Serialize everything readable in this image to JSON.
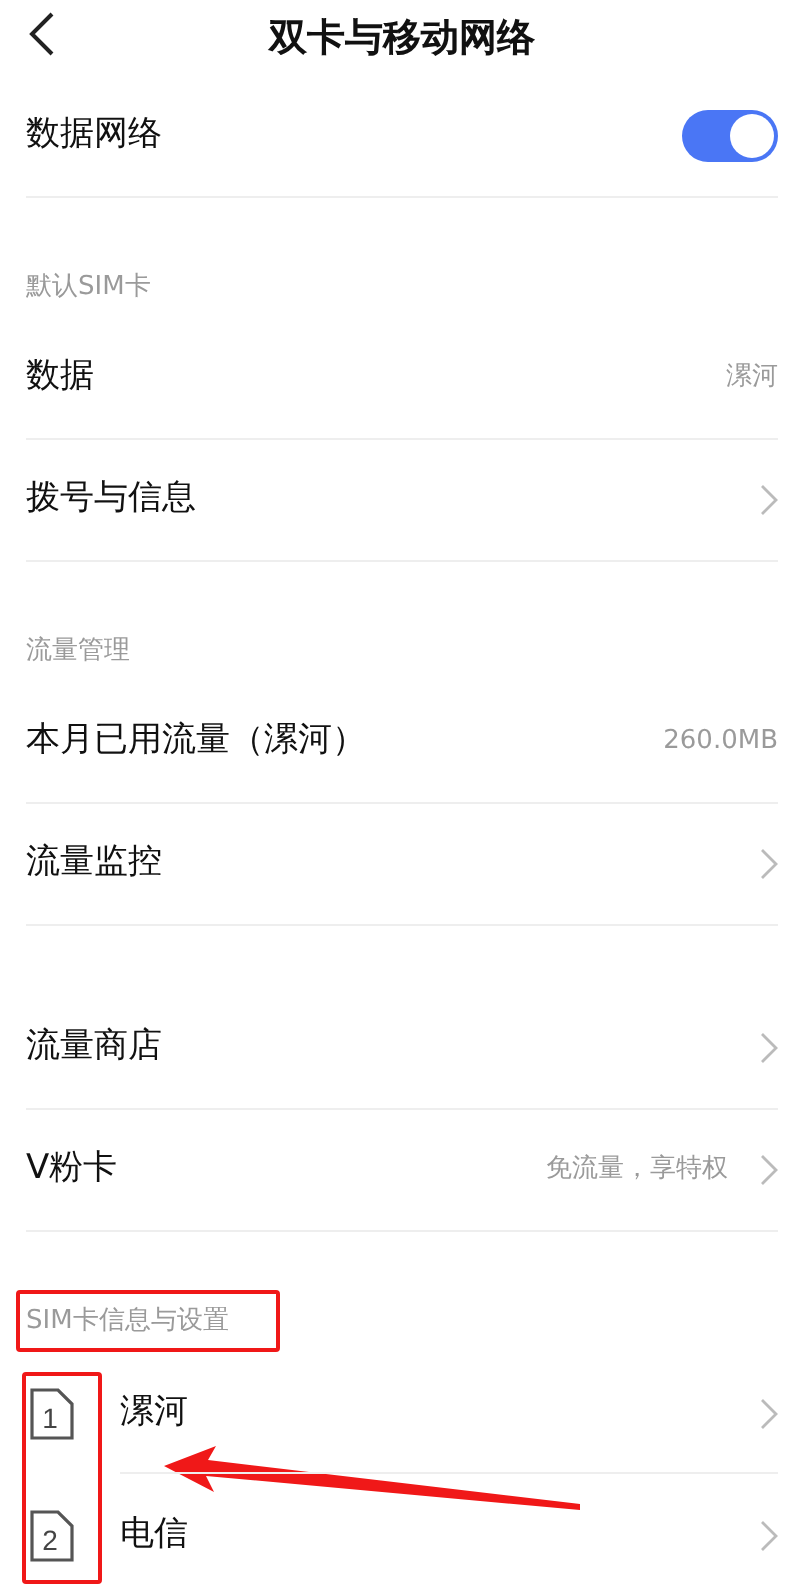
{
  "header": {
    "title": "双卡与移动网络"
  },
  "sections": [
    {
      "items": [
        {
          "kind": "toggle",
          "label": "数据网络",
          "on": true
        }
      ]
    },
    {
      "header": {
        "text": "默认SIM卡"
      },
      "items": [
        {
          "kind": "link",
          "label": "数据",
          "value": "漯河",
          "chevron": false
        },
        {
          "kind": "link",
          "label": "拨号与信息",
          "chevron": true
        }
      ]
    },
    {
      "header": {
        "text": "流量管理"
      },
      "items": [
        {
          "kind": "link",
          "label": "本月已用流量（漯河）",
          "value": "260.0MB",
          "chevron": false
        },
        {
          "kind": "link",
          "label": "流量监控",
          "chevron": true
        }
      ]
    },
    {
      "items": [
        {
          "kind": "link",
          "label": "流量商店",
          "chevron": true
        },
        {
          "kind": "link",
          "label": "V粉卡",
          "value": "免流量，享特权",
          "chevron": true
        }
      ]
    },
    {
      "header": {
        "text": "SIM卡信息与设置",
        "highlighted": true
      },
      "icons_highlighted": true,
      "items": [
        {
          "kind": "sim",
          "slot": "1",
          "label": "漯河",
          "chevron": true,
          "arrow": true
        },
        {
          "kind": "sim",
          "slot": "2",
          "label": "电信",
          "chevron": true
        }
      ]
    }
  ]
}
